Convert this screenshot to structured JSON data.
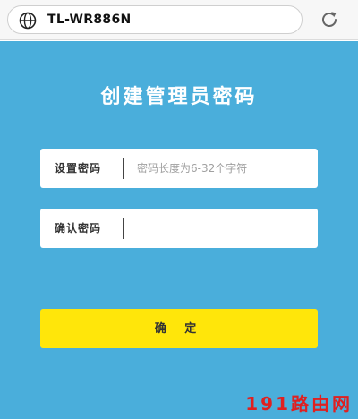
{
  "browser": {
    "url": "TL-WR886N",
    "globe_icon": "globe-icon",
    "reload_icon": "reload-icon"
  },
  "page": {
    "title": "创建管理员密码",
    "background_color": "#4aaedb",
    "set_password": {
      "label": "设置密码",
      "value": "",
      "placeholder": "密码长度为6-32个字符"
    },
    "confirm_password": {
      "label": "确认密码",
      "value": "",
      "placeholder": ""
    },
    "confirm_button_label": "确 定",
    "button_color": "#ffe60a"
  },
  "watermark": "191路由网"
}
